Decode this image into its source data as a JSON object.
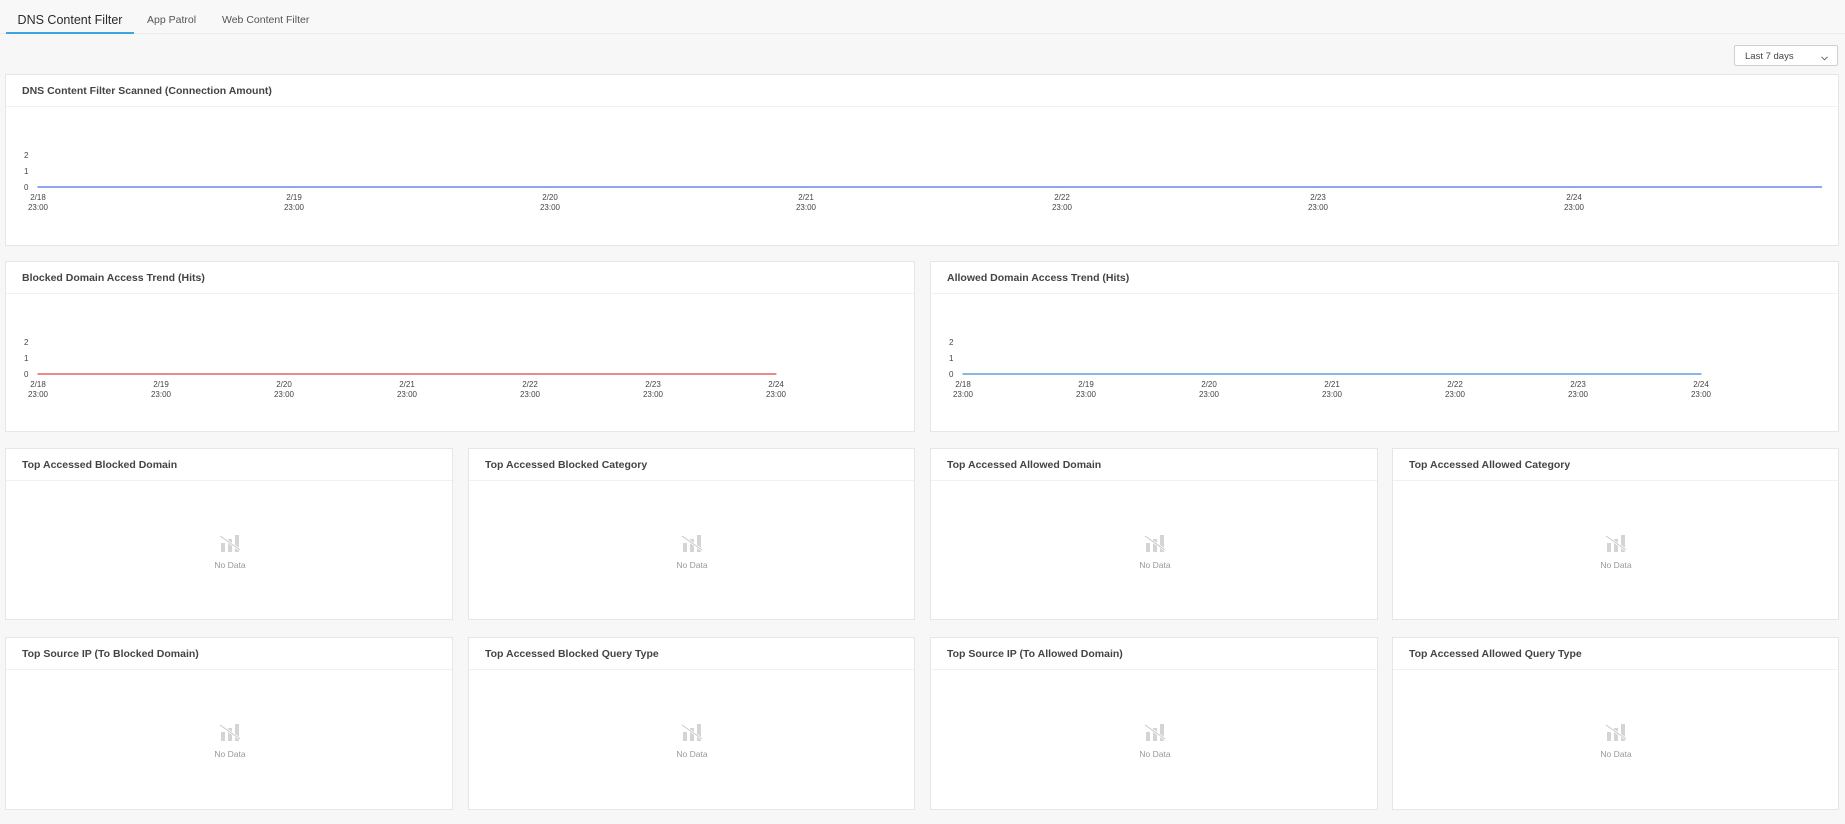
{
  "tabs": [
    {
      "label": "DNS Content Filter",
      "active": true
    },
    {
      "label": "App Patrol",
      "active": false
    },
    {
      "label": "Web Content Filter",
      "active": false
    }
  ],
  "time_range": {
    "selected": "Last 7 days"
  },
  "icons": {
    "dropdown": "chevron-down-icon",
    "empty": "bar-chart-empty-icon"
  },
  "colors": {
    "accent": "#3da4e0",
    "scanned_line": "#4f6fe8",
    "blocked_line": "#e04545",
    "allowed_line": "#3d8fd8"
  },
  "charts": {
    "scanned": {
      "title": "DNS Content Filter Scanned (Connection Amount)"
    },
    "blocked_trend": {
      "title": "Blocked Domain Access Trend (Hits)"
    },
    "allowed_trend": {
      "title": "Allowed Domain Access Trend (Hits)"
    }
  },
  "chart_data": [
    {
      "type": "line",
      "title": "DNS Content Filter Scanned (Connection Amount)",
      "x": [
        "2/18 23:00",
        "2/19 23:00",
        "2/20 23:00",
        "2/21 23:00",
        "2/22 23:00",
        "2/23 23:00",
        "2/24 23:00"
      ],
      "series": [
        {
          "values": [
            0,
            0,
            0,
            0,
            0,
            0,
            0
          ],
          "color": "#4f6fe8"
        }
      ],
      "yticks": [
        0,
        1,
        2
      ],
      "ylim": [
        0,
        2
      ],
      "grid": false
    },
    {
      "type": "line",
      "title": "Blocked Domain Access Trend (Hits)",
      "x": [
        "2/18 23:00",
        "2/19 23:00",
        "2/20 23:00",
        "2/21 23:00",
        "2/22 23:00",
        "2/23 23:00",
        "2/24 23:00"
      ],
      "series": [
        {
          "values": [
            0,
            0,
            0,
            0,
            0,
            0,
            0
          ],
          "color": "#e04545"
        }
      ],
      "yticks": [
        0,
        1,
        2
      ],
      "ylim": [
        0,
        2
      ],
      "grid": false
    },
    {
      "type": "line",
      "title": "Allowed Domain Access Trend (Hits)",
      "x": [
        "2/18 23:00",
        "2/19 23:00",
        "2/20 23:00",
        "2/21 23:00",
        "2/22 23:00",
        "2/23 23:00",
        "2/24 23:00"
      ],
      "series": [
        {
          "values": [
            0,
            0,
            0,
            0,
            0,
            0,
            0
          ],
          "color": "#3d8fd8"
        }
      ],
      "yticks": [
        0,
        1,
        2
      ],
      "ylim": [
        0,
        2
      ],
      "grid": false
    }
  ],
  "panels": [
    {
      "title": "Top Accessed Blocked Domain",
      "empty_text": "No Data"
    },
    {
      "title": "Top Accessed Blocked Category",
      "empty_text": "No Data"
    },
    {
      "title": "Top Accessed Allowed Domain",
      "empty_text": "No Data"
    },
    {
      "title": "Top Accessed Allowed Category",
      "empty_text": "No Data"
    },
    {
      "title": "Top Source IP (To Blocked Domain)",
      "empty_text": "No Data"
    },
    {
      "title": "Top Accessed Blocked Query Type",
      "empty_text": "No Data"
    },
    {
      "title": "Top Source IP (To Allowed Domain)",
      "empty_text": "No Data"
    },
    {
      "title": "Top Accessed Allowed Query Type",
      "empty_text": "No Data"
    }
  ]
}
